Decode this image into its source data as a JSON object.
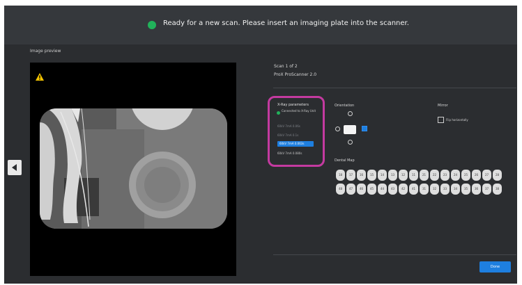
{
  "status": {
    "message": "Ready for a new scan. Please insert an imaging plate into the scanner.",
    "color": "#21b25a"
  },
  "preview": {
    "title": "Image preview"
  },
  "scan": {
    "count": "Scan 1 of 2",
    "scanner": "ProX ProScanner 2.0"
  },
  "xray": {
    "title": "X-Ray parameters",
    "connection": "Connected to X-Ray Unit",
    "options": [
      "60kV 7mA 0.06s",
      "60kV 7mA 0.1s",
      "60kV 7mA 0.063s",
      "60kV 7mA 0.080s"
    ],
    "selected_index": 2
  },
  "orientation": {
    "title": "Orientation"
  },
  "mirror": {
    "title": "Mirror",
    "option": "Flip horizontally",
    "checked": false
  },
  "dental_map": {
    "title": "Dental Map",
    "upper": [
      "18",
      "17",
      "16",
      "15",
      "14",
      "13",
      "12",
      "11",
      "21",
      "22",
      "23",
      "24",
      "25",
      "26",
      "27",
      "28"
    ],
    "lower": [
      "48",
      "47",
      "46",
      "45",
      "44",
      "43",
      "42",
      "41",
      "31",
      "32",
      "33",
      "34",
      "35",
      "36",
      "37",
      "38"
    ]
  },
  "actions": {
    "done": "Done",
    "accent": "#1e7fe0"
  },
  "highlight_color": "#c43aa0"
}
